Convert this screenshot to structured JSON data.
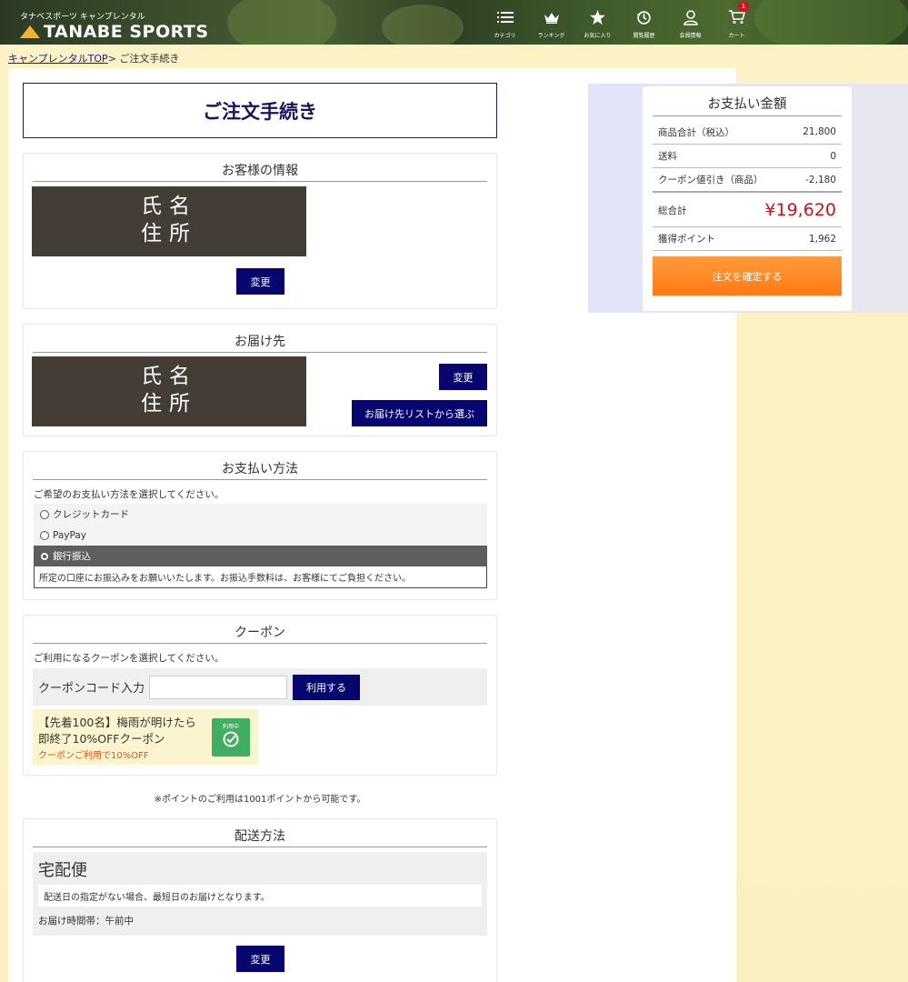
{
  "header": {
    "brand_sub": "タナベスポーツ キャンプレンタル",
    "brand_name": "TANABE SPORTS",
    "nav": [
      {
        "label": "カテゴリ",
        "icon": "list-icon"
      },
      {
        "label": "ランキング",
        "icon": "crown-icon"
      },
      {
        "label": "お気に入り",
        "icon": "star-icon"
      },
      {
        "label": "閲覧履歴",
        "icon": "history-icon"
      },
      {
        "label": "会員情報",
        "icon": "user-icon"
      },
      {
        "label": "カート",
        "icon": "cart-icon",
        "badge": "1"
      }
    ]
  },
  "breadcrumb": {
    "home": "キャンプレンタルTOP",
    "separator": ">",
    "current": "ご注文手続き"
  },
  "page": {
    "title": "ご注文手続き"
  },
  "customer": {
    "heading": "お客様の情報",
    "name": "氏名",
    "address": "住所",
    "change_label": "変更"
  },
  "shipping": {
    "heading": "お届け先",
    "name": "氏名",
    "address": "住所",
    "change_label": "変更",
    "list_label": "お届け先リストから選ぶ"
  },
  "payment": {
    "heading": "お支払い方法",
    "intro": "ご希望のお支払い方法を選択してください。",
    "options": [
      {
        "label": "クレジットカード",
        "selected": false
      },
      {
        "label": "PayPay",
        "selected": false
      },
      {
        "label": "銀行振込",
        "selected": true
      }
    ],
    "note": "所定の口座にお振込みをお願いいたします。お振込手数料は、お客様にてご負担ください。"
  },
  "coupon": {
    "heading": "クーポン",
    "intro": "ご利用になるクーポンを選択してください。",
    "code_label": "クーポンコード入力",
    "code_value": "",
    "apply_label": "利用する",
    "card_title": "【先着100名】梅雨が明けたら即終了10%OFFクーポン",
    "card_sub": "クーポンご利用で10%OFF",
    "badge_label": "利用中"
  },
  "points_note": "※ポイントのご利用は1001ポイントから可能です。",
  "delivery": {
    "heading": "配送方法",
    "method": "宅配便",
    "note": "配送日の指定がない場合、最短日のお届けとなります。",
    "time": "お届け時間帯：午前中",
    "change_label": "変更"
  },
  "summary": {
    "heading": "お支払い金額",
    "rows": [
      {
        "label": "商品合計（税込）",
        "value": "21,800"
      },
      {
        "label": "送料",
        "value": "0"
      },
      {
        "label": "クーポン値引き（商品）",
        "value": "-2,180"
      }
    ],
    "total_label": "総合計",
    "total_value": "¥19,620",
    "points_label": "獲得ポイント",
    "points_value": "1,962",
    "confirm_label": "注文を確定する"
  },
  "colors": {
    "navy_button": "#06066e",
    "total_red": "#c8151d",
    "confirm_orange": "#ff8a25",
    "coupon_green": "#3fae61"
  }
}
